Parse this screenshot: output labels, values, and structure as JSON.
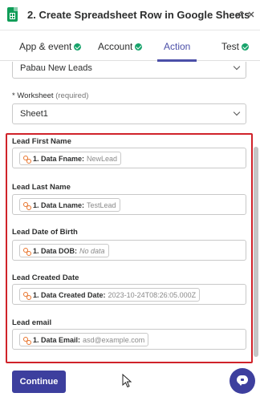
{
  "header": {
    "title": "2. Create Spreadsheet Row in Google Sheets",
    "icons": {
      "app": "google-sheets-icon",
      "edit": "pencil-icon",
      "close": "close-icon"
    }
  },
  "tabs": [
    {
      "label": "App & event",
      "status": "complete"
    },
    {
      "label": "Account",
      "status": "complete"
    },
    {
      "label": "Action",
      "status": "active"
    },
    {
      "label": "Test",
      "status": "complete"
    }
  ],
  "form": {
    "spreadsheet": {
      "value": "Pabau New Leads"
    },
    "worksheet": {
      "label": "Worksheet",
      "required_text": "(required)",
      "value": "Sheet1"
    },
    "fields": [
      {
        "label": "Lead First Name",
        "key": "1. Data Fname:",
        "value": "NewLead"
      },
      {
        "label": "Lead Last Name",
        "key": "1. Data Lname:",
        "value": "TestLead"
      },
      {
        "label": "Lead Date of Birth",
        "key": "1. Data DOB:",
        "value": "No data"
      },
      {
        "label": "Lead Created Date",
        "key": "1. Data Created Date:",
        "value": "2023-10-24T08:26:05.000Z"
      },
      {
        "label": "Lead email",
        "key": "1. Data Email:",
        "value": "asd@example.com"
      }
    ]
  },
  "footer": {
    "continue_label": "Continue",
    "help_icon": "chat-help-icon"
  },
  "colors": {
    "accent": "#3d3f9e",
    "success": "#17a36b",
    "highlight": "#d0232a",
    "pill_icon": "#e8742c"
  }
}
